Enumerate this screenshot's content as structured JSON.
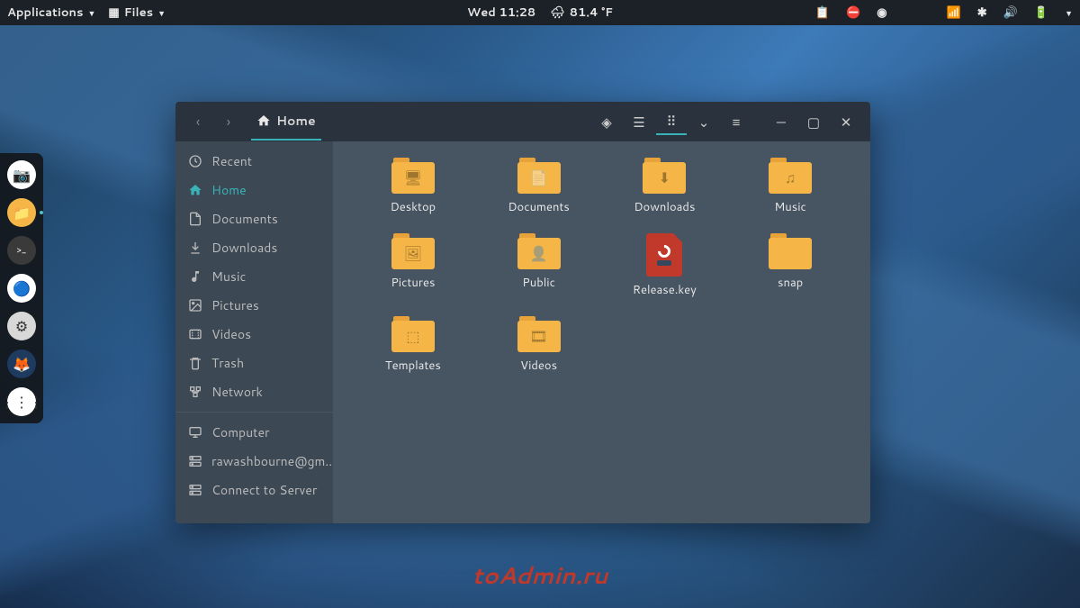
{
  "panel": {
    "applications": "Applications",
    "files": "Files",
    "datetime": "Wed 11:28",
    "temperature": "81.4 °F"
  },
  "dock": {
    "items": [
      {
        "name": "screenshot",
        "bg": "#ffffff",
        "glyph": "📷"
      },
      {
        "name": "files",
        "bg": "#f5b547",
        "glyph": "📁",
        "active": true
      },
      {
        "name": "terminal",
        "bg": "#3a3a3a",
        "glyph": ">_"
      },
      {
        "name": "chrome",
        "bg": "#ffffff",
        "glyph": "🔵"
      },
      {
        "name": "settings",
        "bg": "#d8d8d8",
        "glyph": "⚙"
      },
      {
        "name": "firefox",
        "bg": "#1e3a5f",
        "glyph": "🦊"
      },
      {
        "name": "apps-grid",
        "bg": "#ffffff",
        "glyph": "⋮⋮⋮"
      }
    ]
  },
  "fm": {
    "breadcrumb": "Home",
    "sidebar": {
      "primary": [
        {
          "key": "recent",
          "label": "Recent",
          "icon": "clock"
        },
        {
          "key": "home",
          "label": "Home",
          "icon": "home",
          "active": true
        },
        {
          "key": "documents",
          "label": "Documents",
          "icon": "doc"
        },
        {
          "key": "downloads",
          "label": "Downloads",
          "icon": "download"
        },
        {
          "key": "music",
          "label": "Music",
          "icon": "music"
        },
        {
          "key": "pictures",
          "label": "Pictures",
          "icon": "image"
        },
        {
          "key": "videos",
          "label": "Videos",
          "icon": "video"
        },
        {
          "key": "trash",
          "label": "Trash",
          "icon": "trash"
        },
        {
          "key": "network",
          "label": "Network",
          "icon": "network"
        }
      ],
      "secondary": [
        {
          "key": "computer",
          "label": "Computer",
          "icon": "computer"
        },
        {
          "key": "account",
          "label": "rawashbourne@gm...",
          "icon": "server"
        },
        {
          "key": "connect",
          "label": "Connect to Server",
          "icon": "server"
        }
      ]
    },
    "items": [
      {
        "name": "Desktop",
        "type": "folder",
        "glyph": "🖥"
      },
      {
        "name": "Documents",
        "type": "folder",
        "glyph": "📄"
      },
      {
        "name": "Downloads",
        "type": "folder",
        "glyph": "⬇"
      },
      {
        "name": "Music",
        "type": "folder",
        "glyph": "♫"
      },
      {
        "name": "Pictures",
        "type": "folder",
        "glyph": "🖼"
      },
      {
        "name": "Public",
        "type": "folder",
        "glyph": "👤"
      },
      {
        "name": "Release.key",
        "type": "file"
      },
      {
        "name": "snap",
        "type": "folder",
        "glyph": ""
      },
      {
        "name": "Templates",
        "type": "folder",
        "glyph": "⬚"
      },
      {
        "name": "Videos",
        "type": "folder",
        "glyph": "🎞"
      }
    ]
  },
  "watermark": "toAdmin.ru"
}
